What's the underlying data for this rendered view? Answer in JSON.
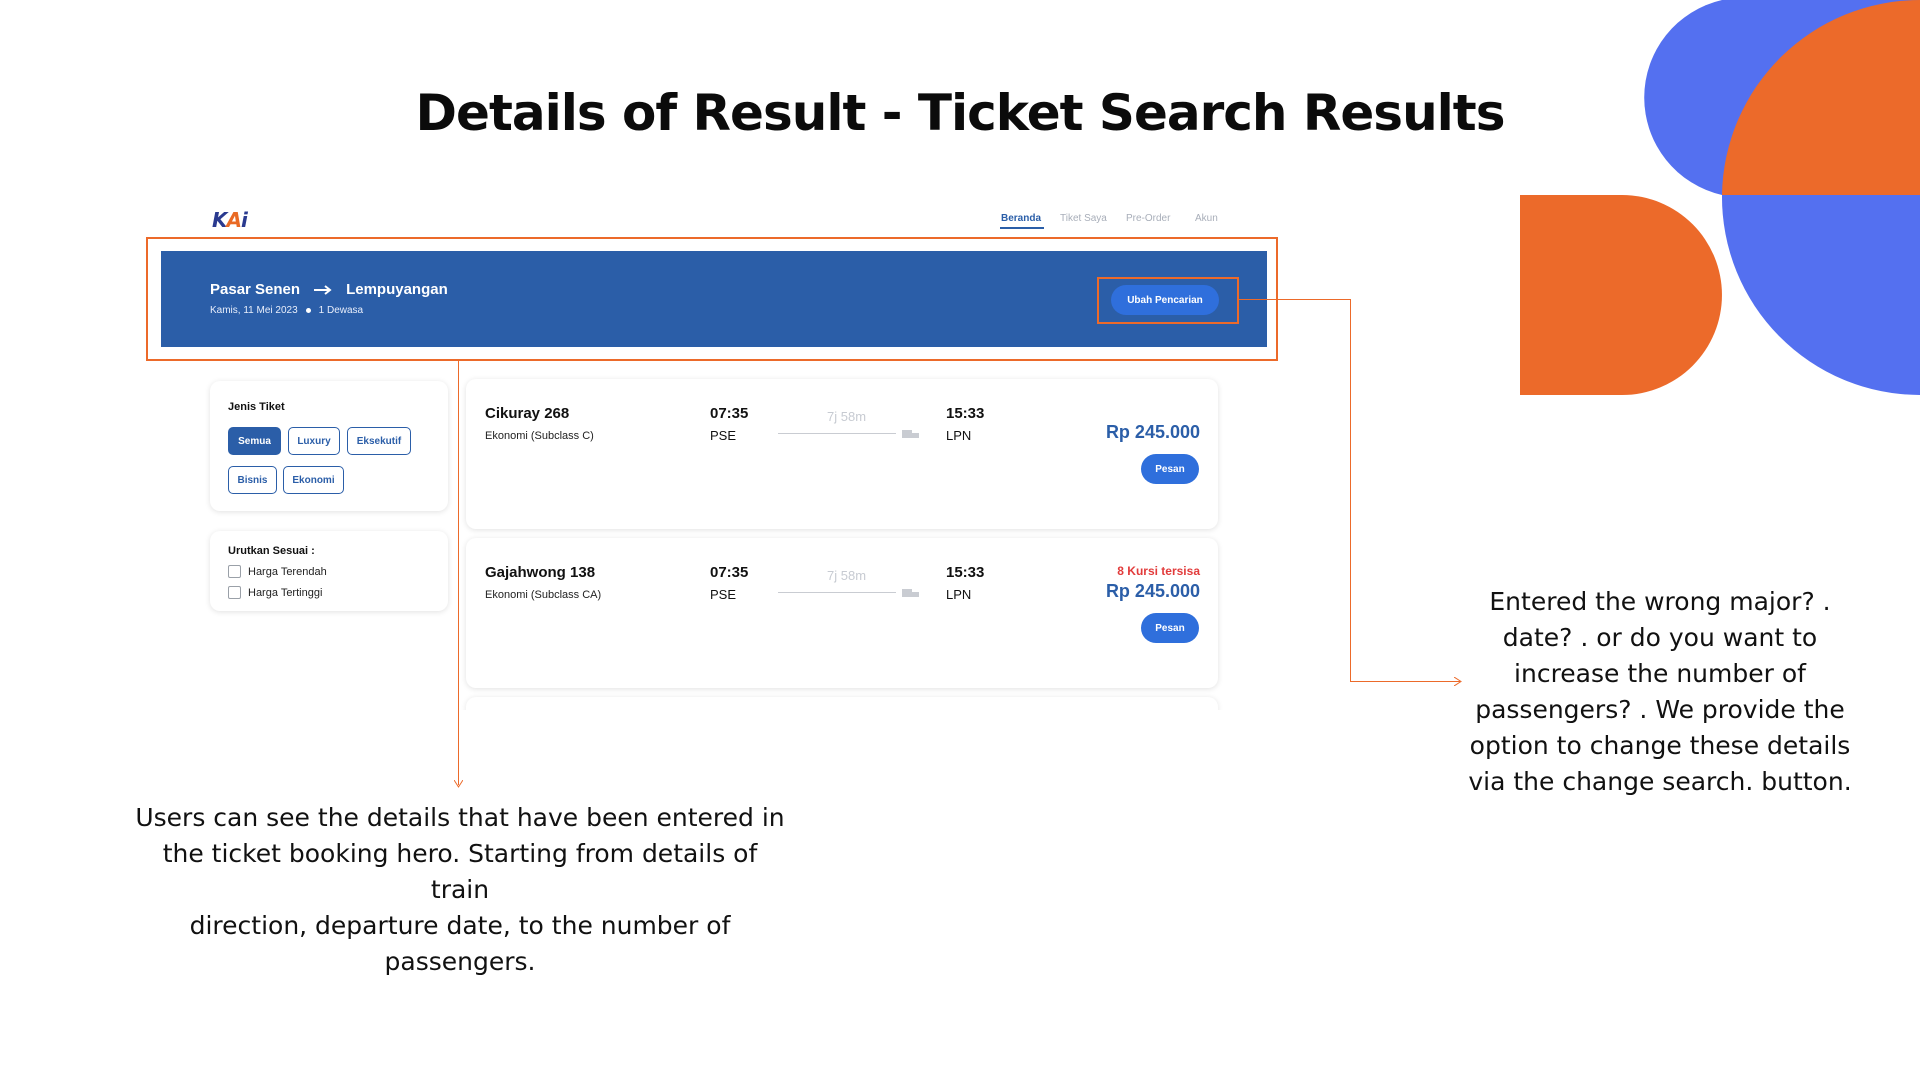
{
  "slide": {
    "title": "Details of Result - Ticket Search Results"
  },
  "colors": {
    "accent_orange": "#ec6a2a",
    "accent_blue": "#5470f0",
    "brand_blue": "#2b5ea8",
    "button_blue": "#2f6fdc",
    "alert_red": "#e23b3b"
  },
  "app": {
    "logo": {
      "k": "K",
      "a": "A",
      "i": "i"
    },
    "nav": [
      {
        "label": "Beranda",
        "active": true
      },
      {
        "label": "Tiket Saya",
        "active": false
      },
      {
        "label": "Pre-Order",
        "active": false
      },
      {
        "label": "Akun",
        "active": false
      }
    ],
    "hero": {
      "origin": "Pasar Senen",
      "arrow_icon": "arrow-right-icon",
      "destination": "Lempuyangan",
      "date": "Kamis, 11 Mei 2023",
      "passengers": "1 Dewasa",
      "change_button": "Ubah Pencarian"
    },
    "filters": {
      "ticket_type_title": "Jenis Tiket",
      "ticket_types": [
        {
          "label": "Semua",
          "active": true
        },
        {
          "label": "Luxury",
          "active": false
        },
        {
          "label": "Eksekutif",
          "active": false
        },
        {
          "label": "Bisnis",
          "active": false
        },
        {
          "label": "Ekonomi",
          "active": false
        }
      ],
      "sort_title": "Urutkan Sesuai :",
      "sort_options": [
        {
          "label": "Harga Terendah",
          "checked": false
        },
        {
          "label": "Harga Tertinggi",
          "checked": false
        }
      ]
    },
    "results": [
      {
        "name": "Cikuray 268",
        "class": "Ekonomi (Subclass C)",
        "depart_time": "07:35",
        "depart_station": "PSE",
        "duration": "7j 58m",
        "arrive_time": "15:33",
        "arrive_station": "LPN",
        "seats_left": "",
        "price": "Rp 245.000",
        "book_label": "Pesan"
      },
      {
        "name": "Gajahwong 138",
        "class": "Ekonomi (Subclass CA)",
        "depart_time": "07:35",
        "depart_station": "PSE",
        "duration": "7j 58m",
        "arrive_time": "15:33",
        "arrive_station": "LPN",
        "seats_left": "8 Kursi tersisa",
        "price": "Rp 245.000",
        "book_label": "Pesan"
      }
    ]
  },
  "annotations": {
    "hero_caption_lines": [
      "Users can see the details that have been entered in",
      "the ticket booking hero. Starting from details of train",
      "direction, departure date, to the number of",
      "passengers."
    ],
    "button_caption_lines": [
      "Entered the wrong major? .",
      "date? . or do you want to",
      "increase the number of",
      "passengers? . We provide the",
      "option to change these details",
      "via the change search. button."
    ]
  }
}
